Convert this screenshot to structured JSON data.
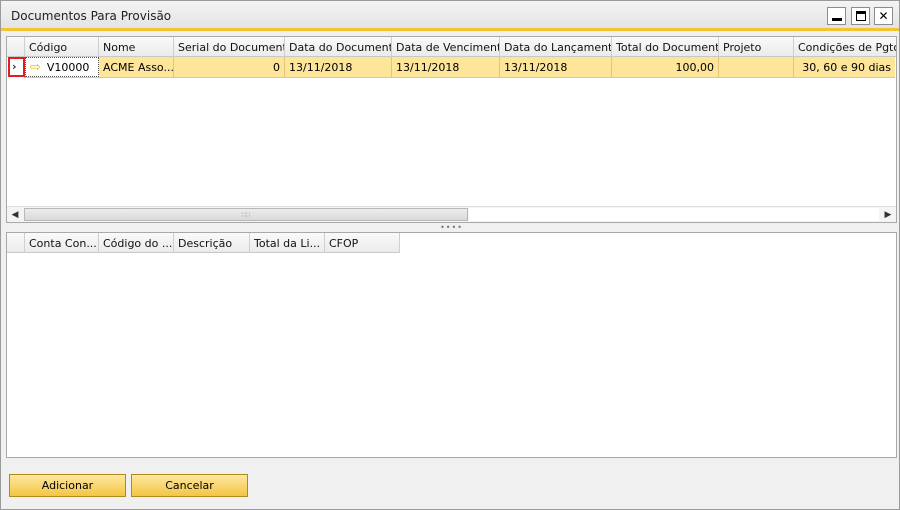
{
  "window": {
    "title": "Documentos Para Provisão"
  },
  "top_grid": {
    "columns": [
      "Código",
      "Nome",
      "Serial do Documento",
      "Data do Documento",
      "Data de Vencimento",
      "Data do Lançamento",
      "Total do Documento",
      "Projeto",
      "Condições de Pgto"
    ],
    "rows": [
      {
        "codigo": "V10000",
        "nome": "ACME Asso...",
        "serial": "0",
        "data_documento": "13/11/2018",
        "data_vencimento": "13/11/2018",
        "data_lancamento": "13/11/2018",
        "total": "100,00",
        "projeto": "",
        "condicoes": "30, 60 e 90 dias"
      }
    ]
  },
  "bottom_grid": {
    "columns": [
      "Conta Con...",
      "Código do ...",
      "Descrição",
      "Total da Li...",
      "CFOP"
    ]
  },
  "buttons": {
    "add": "Adicionar",
    "cancel": "Cancelar"
  },
  "colors": {
    "accent": "#f5c233",
    "selected_row": "#fde59a",
    "button": "#f4c544"
  }
}
